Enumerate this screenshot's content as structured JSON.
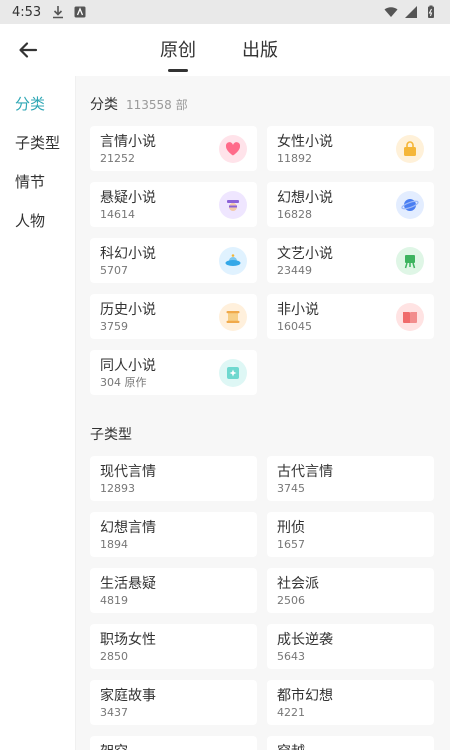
{
  "status_bar": {
    "time": "4:53"
  },
  "header": {
    "tabs": [
      "原创",
      "出版"
    ],
    "active_tab": "原创"
  },
  "sidebar": {
    "items": [
      "分类",
      "子类型",
      "情节",
      "人物"
    ],
    "active": "分类"
  },
  "category_section": {
    "title": "分类",
    "count_text": "113558 部",
    "cards": [
      {
        "name": "言情小说",
        "count": "21252",
        "icon": "heart-icon",
        "icon_bg": "#ffe3ea",
        "icon_color": "#ff6b8a"
      },
      {
        "name": "女性小说",
        "count": "11892",
        "icon": "bag-icon",
        "icon_bg": "#fff1d9",
        "icon_color": "#f5b638"
      },
      {
        "name": "悬疑小说",
        "count": "14614",
        "icon": "detective-icon",
        "icon_bg": "#efe6ff",
        "icon_color": "#8c62d8"
      },
      {
        "name": "幻想小说",
        "count": "16828",
        "icon": "planet-icon",
        "icon_bg": "#e3edff",
        "icon_color": "#4a7ef2"
      },
      {
        "name": "科幻小说",
        "count": "5707",
        "icon": "ufo-icon",
        "icon_bg": "#e0f2ff",
        "icon_color": "#35a8e8"
      },
      {
        "name": "文艺小说",
        "count": "23449",
        "icon": "easel-icon",
        "icon_bg": "#dff6e6",
        "icon_color": "#3db35f"
      },
      {
        "name": "历史小说",
        "count": "3759",
        "icon": "scroll-icon",
        "icon_bg": "#fff0dc",
        "icon_color": "#f0a94a"
      },
      {
        "name": "非小说",
        "count": "16045",
        "icon": "book-icon",
        "icon_bg": "#ffe3e3",
        "icon_color": "#f06b6b"
      },
      {
        "name": "同人小说",
        "count": "304 原作",
        "icon": "sparkle-icon",
        "icon_bg": "#def7f5",
        "icon_color": "#3cc2b8"
      }
    ]
  },
  "subtype_section": {
    "title": "子类型",
    "cards": [
      {
        "name": "现代言情",
        "count": "12893"
      },
      {
        "name": "古代言情",
        "count": "3745"
      },
      {
        "name": "幻想言情",
        "count": "1894"
      },
      {
        "name": "刑侦",
        "count": "1657"
      },
      {
        "name": "生活悬疑",
        "count": "4819"
      },
      {
        "name": "社会派",
        "count": "2506"
      },
      {
        "name": "职场女性",
        "count": "2850"
      },
      {
        "name": "成长逆袭",
        "count": "5643"
      },
      {
        "name": "家庭故事",
        "count": "3437"
      },
      {
        "name": "都市幻想",
        "count": "4221"
      },
      {
        "name": "架空",
        "count": ""
      },
      {
        "name": "穿越",
        "count": ""
      }
    ]
  }
}
